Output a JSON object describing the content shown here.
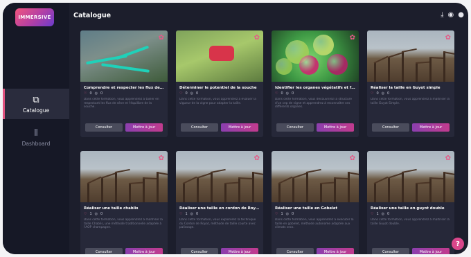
{
  "app": {
    "logo_text": "IMMERSIVE",
    "page_title": "Catalogue"
  },
  "sidebar": {
    "items": [
      {
        "label": "Catalogue",
        "icon": "copy-icon",
        "active": true
      },
      {
        "label": "Dashboard",
        "icon": "bar-chart-icon",
        "active": false
      }
    ]
  },
  "topbar": {
    "icons": [
      "download-icon",
      "location-pin-icon",
      "bell-icon"
    ]
  },
  "cards": [
    {
      "title": "Comprendre et respecter les flux de sève",
      "likes": "0",
      "views": "0",
      "desc": "Dans cette formation, vous apprendrez à tailler en respectant les flux de sève et l'équilibre de la souche.",
      "scene": "flow"
    },
    {
      "title": "Déterminer le potentiel de la souche",
      "likes": "0",
      "views": "0",
      "desc": "Dans cette formation, vous apprendrez à évaluer la vigueur de la vigne pour adapter la taille.",
      "scene": "prune"
    },
    {
      "title": "Identifier les organes végétatifs et fructi...",
      "likes": "0",
      "views": "0",
      "desc": "Dans cette formation, vous découvrirez la structure d'un cep de vigne et apprendrez à reconnaître ses différents organes.",
      "scene": "organs"
    },
    {
      "title": "Réaliser la taille en Guyot simple",
      "likes": "0",
      "views": "0",
      "desc": "Dans cette formation, vous apprendrez à maîtriser la taille Guyot Simple.",
      "scene": "vine"
    },
    {
      "title": "Réaliser une taille chablis",
      "likes": "1",
      "views": "0",
      "desc": "Dans cette formation, vous apprendrez à maîtriser la taille Chablis, une méthode traditionnelle adaptée à l'AOP champagne.",
      "scene": "vine"
    },
    {
      "title": "Réaliser une taille en cordon de Royat",
      "likes": "1",
      "views": "0",
      "desc": "Dans cette formation, vous explorerez la technique du Cordon de Royat, méthode de taille courte avec palissage.",
      "scene": "vine"
    },
    {
      "title": "Réaliser une taille en Gobelet",
      "likes": "1",
      "views": "0",
      "desc": "Dans cette formation, vous apprendrez à exécuter la taille en gobelet, méthode autonome adaptée aux climats secs.",
      "scene": "vine"
    },
    {
      "title": "Réaliser une taille en guyot double",
      "likes": "1",
      "views": "0",
      "desc": "Dans cette formation, vous apprendrez à maîtriser la taille Guyot double.",
      "scene": "vine"
    }
  ],
  "buttons": {
    "consult": "Consulter",
    "update": "Mettre à jour"
  },
  "help": {
    "label": "?"
  },
  "colors": {
    "accent": "#e0527f",
    "update_start": "#8b3fae",
    "update_end": "#c23b8e",
    "background": "#1c1e2c"
  }
}
